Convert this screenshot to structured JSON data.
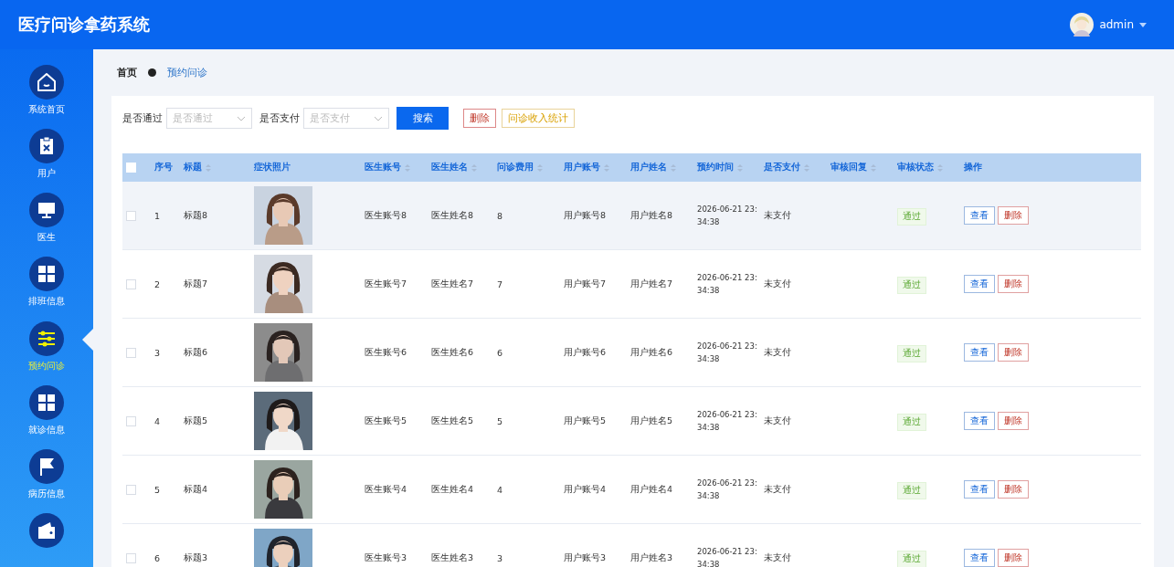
{
  "header": {
    "title": "医疗问诊拿药系统",
    "user": {
      "name": "admin"
    }
  },
  "sidebar": {
    "items": [
      {
        "label": "系统首页",
        "kind": "home",
        "selected": false
      },
      {
        "label": "用户",
        "kind": "clipboard",
        "selected": false
      },
      {
        "label": "医生",
        "kind": "monitor",
        "selected": false
      },
      {
        "label": "排班信息",
        "kind": "grid",
        "selected": false
      },
      {
        "label": "预约问诊",
        "kind": "sliders",
        "selected": true
      },
      {
        "label": "就诊信息",
        "kind": "grid",
        "selected": false
      },
      {
        "label": "病历信息",
        "kind": "flag",
        "selected": false
      },
      {
        "kind": "wallet",
        "selected": false
      }
    ]
  },
  "breadcrumb": [
    {
      "label": "首页"
    },
    {
      "label": "预约问诊"
    }
  ],
  "filters": [
    {
      "label": "是否通过",
      "placeholder": "是否通过"
    },
    {
      "label": "是否支付",
      "placeholder": "是否支付"
    }
  ],
  "buttons": [
    {
      "label": "搜索",
      "kind": "primary"
    },
    {
      "label": "删除",
      "kind": "danger"
    },
    {
      "label": "问诊收入统计",
      "kind": "warning"
    }
  ],
  "table": {
    "columns": [
      {
        "label": "序号",
        "sortable": false
      },
      {
        "label": "标题",
        "sortable": true
      },
      {
        "label": "症状照片",
        "sortable": false
      },
      {
        "label": "医生账号",
        "sortable": true
      },
      {
        "label": "医生姓名",
        "sortable": true
      },
      {
        "label": "问诊费用",
        "sortable": true
      },
      {
        "label": "用户账号",
        "sortable": true
      },
      {
        "label": "用户姓名",
        "sortable": true
      },
      {
        "label": "预约时间",
        "sortable": true
      },
      {
        "label": "是否支付",
        "sortable": true
      },
      {
        "label": "审核回复",
        "sortable": true
      },
      {
        "label": "审核状态",
        "sortable": true
      },
      {
        "label": "操作",
        "sortable": false
      }
    ],
    "header_checked": false,
    "rows": [
      {
        "checked": false,
        "highlighted": true,
        "index": "1",
        "title": "标题8",
        "photo": {
          "kind": "picture"
        },
        "doctor_account": "医生账号8",
        "doctor_name": "医生姓名8",
        "fee": "8",
        "user_account": "用户账号8",
        "user_name": "用户姓名8",
        "time": "2026-06-21 23:34:38",
        "paid": "未支付",
        "status": "通过",
        "actions": [
          "查看",
          "删除"
        ]
      },
      {
        "checked": false,
        "highlighted": false,
        "index": "2",
        "title": "标题7",
        "photo": {
          "kind": "picture"
        },
        "doctor_account": "医生账号7",
        "doctor_name": "医生姓名7",
        "fee": "7",
        "user_account": "用户账号7",
        "user_name": "用户姓名7",
        "time": "2026-06-21 23:34:38",
        "paid": "未支付",
        "status": "通过",
        "actions": [
          "查看",
          "删除"
        ]
      },
      {
        "checked": false,
        "highlighted": false,
        "index": "3",
        "title": "标题6",
        "photo": {
          "kind": "picture"
        },
        "doctor_account": "医生账号6",
        "doctor_name": "医生姓名6",
        "fee": "6",
        "user_account": "用户账号6",
        "user_name": "用户姓名6",
        "time": "2026-06-21 23:34:38",
        "paid": "未支付",
        "status": "通过",
        "actions": [
          "查看",
          "删除"
        ]
      },
      {
        "checked": false,
        "highlighted": false,
        "index": "4",
        "title": "标题5",
        "photo": {
          "kind": "picture"
        },
        "doctor_account": "医生账号5",
        "doctor_name": "医生姓名5",
        "fee": "5",
        "user_account": "用户账号5",
        "user_name": "用户姓名5",
        "time": "2026-06-21 23:34:38",
        "paid": "未支付",
        "status": "通过",
        "actions": [
          "查看",
          "删除"
        ]
      },
      {
        "checked": false,
        "highlighted": false,
        "index": "5",
        "title": "标题4",
        "photo": {
          "kind": "picture"
        },
        "doctor_account": "医生账号4",
        "doctor_name": "医生姓名4",
        "fee": "4",
        "user_account": "用户账号4",
        "user_name": "用户姓名4",
        "time": "2026-06-21 23:34:38",
        "paid": "未支付",
        "status": "通过",
        "actions": [
          "查看",
          "删除"
        ]
      },
      {
        "checked": false,
        "highlighted": false,
        "index": "6",
        "title": "标题3",
        "photo": {
          "kind": "picture"
        },
        "doctor_account": "医生账号3",
        "doctor_name": "医生姓名3",
        "fee": "3",
        "user_account": "用户账号3",
        "user_name": "用户姓名3",
        "time": "2026-06-21 23:34:38",
        "paid": "未支付",
        "status": "通过",
        "actions": [
          "查看",
          "删除"
        ]
      }
    ]
  }
}
